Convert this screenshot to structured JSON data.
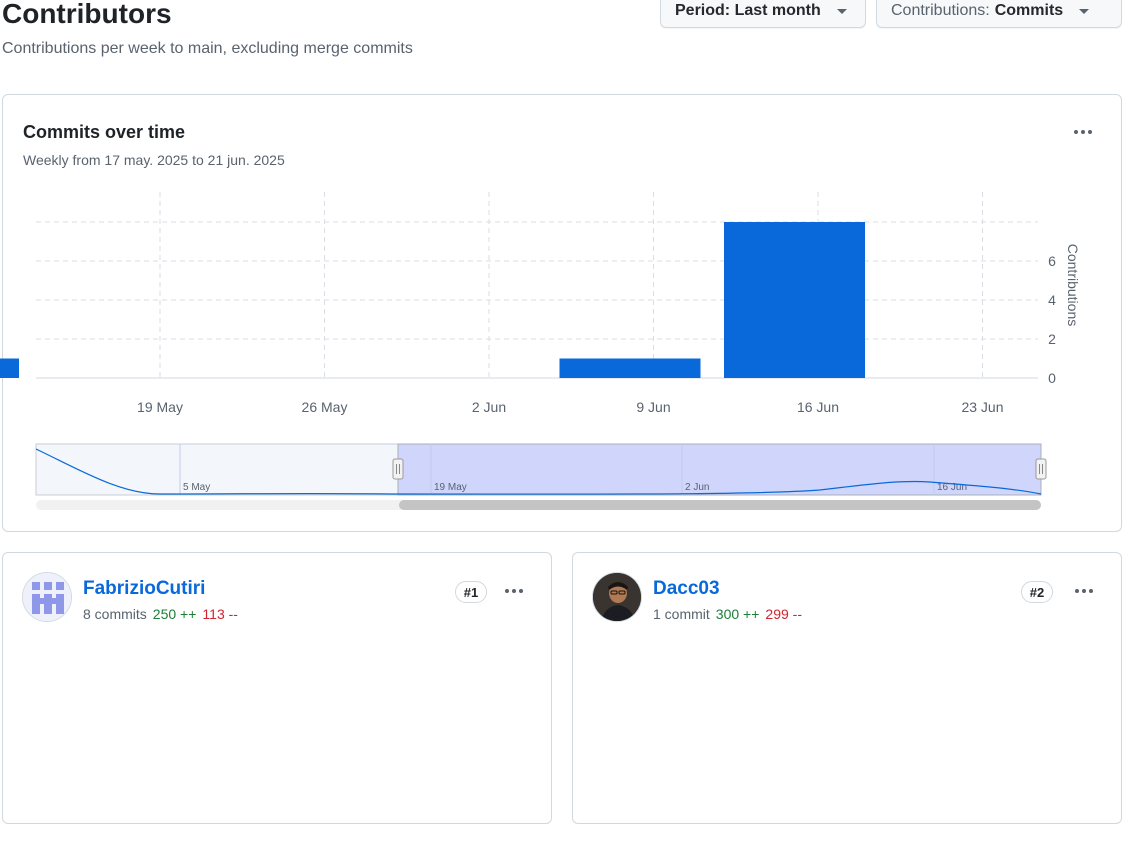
{
  "header": {
    "title": "Contributors",
    "subtitle": "Contributions per week to main, excluding merge commits",
    "period_label": "Period: Last month",
    "contributions_prefix": "Contributions:",
    "contributions_value": "Commits"
  },
  "main_chart": {
    "title": "Commits over time",
    "subtitle": "Weekly from 17 may. 2025 to 21 jun. 2025",
    "menu_icon": "kebab-horizontal-icon"
  },
  "navigator": {
    "labels": [
      "5 May",
      "19 May",
      "2 Jun",
      "16 Jun"
    ]
  },
  "contributors": [
    {
      "name": "FabrizioCutiri",
      "commits": "8 commits",
      "additions": "250 ++",
      "deletions": "113 --",
      "rank": "#1",
      "avatar": "identicon"
    },
    {
      "name": "Dacc03",
      "commits": "1 commit",
      "additions": "300 ++",
      "deletions": "299 --",
      "rank": "#2",
      "avatar": "photo"
    }
  ],
  "colors": {
    "bar": "#0969da",
    "accent": "#0969da",
    "additions": "#1a7f37",
    "deletions": "#d1242f",
    "navigator_selection": "#cfd5fb"
  },
  "chart_data": [
    {
      "type": "bar",
      "title": "Commits over time",
      "ylabel": "Contributions",
      "xticks": [
        "19 May",
        "26 May",
        "2 Jun",
        "9 Jun",
        "16 Jun",
        "23 Jun"
      ],
      "yticks": [
        0,
        2,
        4,
        6
      ],
      "ylim": [
        0,
        8
      ],
      "grid": true,
      "bars": [
        {
          "start": "2025-05-12",
          "end": "2025-05-13",
          "value": 1
        },
        {
          "start": "2025-06-05",
          "end": "2025-06-11",
          "value": 1
        },
        {
          "start": "2025-06-12",
          "end": "2025-06-18",
          "value": 8
        }
      ]
    },
    {
      "type": "bar",
      "title": "FabrizioCutiri",
      "ylabel": "Contributions",
      "xticks": [
        "19 May",
        "26 May",
        "2 Jun",
        "9 Jun",
        "16 Jun",
        "23 Jun"
      ],
      "yticks": [
        0,
        2,
        4,
        6
      ],
      "ylim": [
        0,
        8
      ],
      "grid": true,
      "bars": [
        {
          "start": "2025-06-12",
          "end": "2025-06-18",
          "value": 8
        }
      ]
    },
    {
      "type": "bar",
      "title": "Dacc03",
      "ylabel": "Contributions",
      "xticks": [
        "19 May",
        "26 May",
        "2 Jun",
        "9 Jun",
        "16 Jun",
        "23 Jun"
      ],
      "yticks": [
        0,
        2,
        4,
        6
      ],
      "ylim": [
        0,
        8
      ],
      "grid": true,
      "bars": [
        {
          "start": "2025-06-05",
          "end": "2025-06-11",
          "value": 1
        }
      ]
    }
  ]
}
